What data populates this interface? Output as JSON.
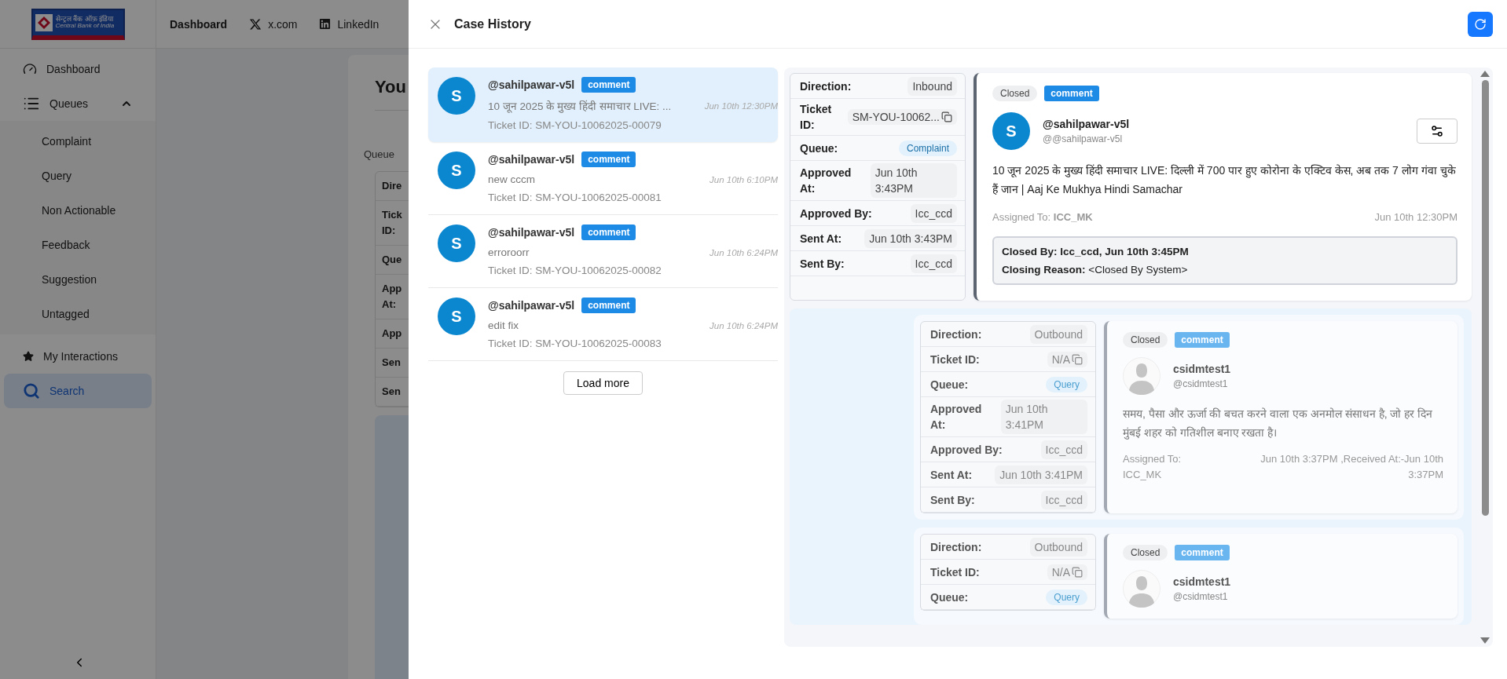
{
  "logo": {
    "hindi": "सेन्ट्रल बैंक ऑफ़ इंडिया",
    "english": "Central Bank of India"
  },
  "top_nav": [
    {
      "label": "Dashboard",
      "selected": true
    },
    {
      "label": "x.com",
      "selected": false
    },
    {
      "label": "LinkedIn",
      "selected": false
    }
  ],
  "sidebar": {
    "items": [
      {
        "label": "Dashboard",
        "selected": false
      },
      {
        "label": "Queues",
        "selected": false,
        "expanded": true,
        "children": [
          {
            "label": "Complaint",
            "selected": false
          },
          {
            "label": "Query",
            "selected": false
          },
          {
            "label": "Non Actionable",
            "selected": false
          },
          {
            "label": "Feedback",
            "selected": false
          },
          {
            "label": "Suggestion",
            "selected": false
          },
          {
            "label": "Untagged",
            "selected": false
          }
        ]
      },
      {
        "label": "My Interactions",
        "selected": false
      },
      {
        "label": "Search",
        "selected": true
      }
    ]
  },
  "background_page": {
    "title": "You",
    "section_label": "Queue",
    "table_rows": [
      "Dire",
      "Tick ID:",
      "Que",
      "App At:",
      "App",
      "Sen",
      "Sen"
    ]
  },
  "drawer": {
    "title": "Case History",
    "cases": [
      {
        "avatar": "S",
        "handle": "@sahilpawar-v5l",
        "tag": "comment",
        "preview": "10 जून 2025 के मुख्य हिंदी समाचार LIVE: ...",
        "ticket": "Ticket ID: SM-YOU-10062025-00079",
        "time": "Jun 10th 12:30PM",
        "selected": true
      },
      {
        "avatar": "S",
        "handle": "@sahilpawar-v5l",
        "tag": "comment",
        "preview": "new cccm",
        "ticket": "Ticket ID: SM-YOU-10062025-00081",
        "time": "Jun 10th 6:10PM",
        "selected": false
      },
      {
        "avatar": "S",
        "handle": "@sahilpawar-v5l",
        "tag": "comment",
        "preview": "erroroorr",
        "ticket": "Ticket ID: SM-YOU-10062025-00082",
        "time": "Jun 10th 6:24PM",
        "selected": false
      },
      {
        "avatar": "S",
        "handle": "@sahilpawar-v5l",
        "tag": "comment",
        "preview": "edit fix",
        "ticket": "Ticket ID: SM-YOU-10062025-00083",
        "time": "Jun 10th 6:24PM",
        "selected": false
      }
    ],
    "load_more": "Load more",
    "entry": {
      "meta": [
        {
          "kind": "text",
          "label": "Direction:",
          "value": "Inbound"
        },
        {
          "kind": "copy",
          "label": "Ticket ID:",
          "value": "SM-YOU-10062..."
        },
        {
          "kind": "tag",
          "label": "Queue:",
          "value": "Complaint"
        },
        {
          "kind": "text",
          "label": "Approved At:",
          "value": "Jun 10th 3:43PM"
        },
        {
          "kind": "text",
          "label": "Approved By:",
          "value": "Icc_ccd"
        },
        {
          "kind": "text",
          "label": "Sent At:",
          "value": "Jun 10th 3:43PM"
        },
        {
          "kind": "text",
          "label": "Sent By:",
          "value": "Icc_ccd"
        }
      ],
      "card": {
        "status": "Closed",
        "tag": "comment",
        "avatar": {
          "kind": "letter",
          "letter": "S"
        },
        "name": "@sahilpawar-v5l",
        "handle": "@@sahilpawar-v5l",
        "message": "10 जून 2025 के मुख्य हिंदी समाचार LIVE: दिल्ली में 700 पार हुए कोरोना के एक्टिव केस, अब तक 7 लोग गंवा चुके हैं जान | Aaj Ke Mukhya Hindi Samachar",
        "assigned": "Assigned To: **ICC_MK**",
        "time": "Jun 10th 12:30PM",
        "closed_by": "Closed By: Icc_ccd, Jun 10th 3:45PM",
        "closing_reason": "**Closing Reason:** <Closed By System>"
      }
    },
    "replies": [
      {
        "meta": [
          {
            "kind": "text",
            "label": "Direction:",
            "value": "Outbound"
          },
          {
            "kind": "copy",
            "label": "Ticket ID:",
            "value": "N/A"
          },
          {
            "kind": "tag",
            "label": "Queue:",
            "value": "Query"
          },
          {
            "kind": "text",
            "label": "Approved At:",
            "value": "Jun 10th 3:41PM"
          },
          {
            "kind": "text",
            "label": "Approved By:",
            "value": "Icc_ccd"
          },
          {
            "kind": "text",
            "label": "Sent At:",
            "value": "Jun 10th 3:41PM"
          },
          {
            "kind": "text",
            "label": "Sent By:",
            "value": "Icc_ccd"
          }
        ],
        "card": {
          "status": "Closed",
          "tag": "comment",
          "avatar": {
            "kind": "silhouette"
          },
          "name": "csidmtest1",
          "handle": "@csidmtest1",
          "message": "समय, पैसा और ऊर्जा की बचत करने वाला एक अनमोल संसाधन है, जो हर दिन मुंबई शहर को गतिशील बनाए रखता है।",
          "assigned": "Assigned To: ICC_MK",
          "time": "Jun 10th 3:37PM ,Received At:-Jun 10th 3:37PM"
        }
      },
      {
        "meta": [
          {
            "kind": "text",
            "label": "Direction:",
            "value": "Outbound"
          },
          {
            "kind": "copy",
            "label": "Ticket ID:",
            "value": "N/A"
          },
          {
            "kind": "tag",
            "label": "Queue:",
            "value": "Query"
          }
        ],
        "card": {
          "status": "Closed",
          "tag": "comment",
          "avatar": {
            "kind": "silhouette"
          },
          "name": "csidmtest1",
          "handle": "@csidmtest1"
        }
      }
    ]
  }
}
